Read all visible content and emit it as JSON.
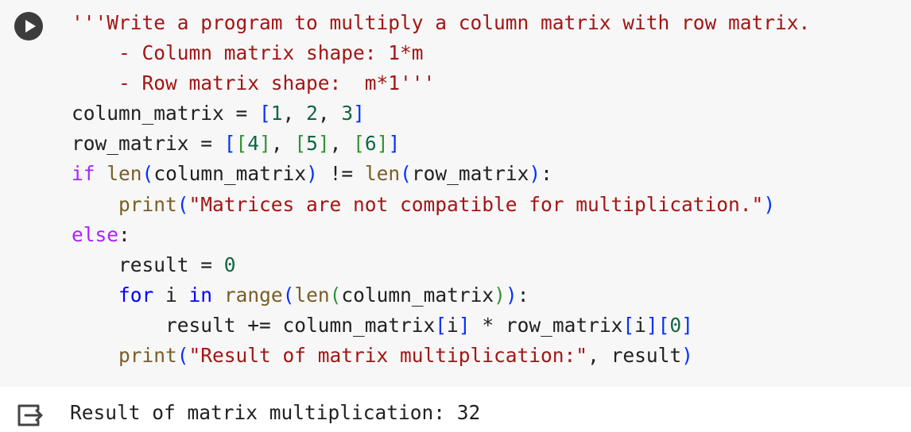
{
  "cell": {
    "run_button_icon": "play-circle-icon",
    "code_lines": [
      "'''Write a program to multiply a column matrix with row matrix.",
      "    - Column matrix shape: 1*m",
      "    - Row matrix shape:  m*1'''",
      "column_matrix = [1, 2, 3]",
      "row_matrix = [[4], [5], [6]]",
      "if len(column_matrix) != len(row_matrix):",
      "    print(\"Matrices are not compatible for multiplication.\")",
      "else:",
      "    result = 0",
      "    for i in range(len(column_matrix)):",
      "        result += column_matrix[i] * row_matrix[i][0]",
      "    print(\"Result of matrix multiplication:\", result)"
    ]
  },
  "output": {
    "icon": "output-arrow-icon",
    "text": "Result of matrix multiplication: 32"
  },
  "colors": {
    "string": "#a31515",
    "number": "#116644",
    "keyword_control": "#aa22ff",
    "keyword_loop": "#0000ff",
    "function": "#795e26",
    "bracket_level1": "#0431fa",
    "bracket_level2": "#319331",
    "bracket_level3": "#7b3814",
    "cell_background": "#f7f7f7"
  }
}
